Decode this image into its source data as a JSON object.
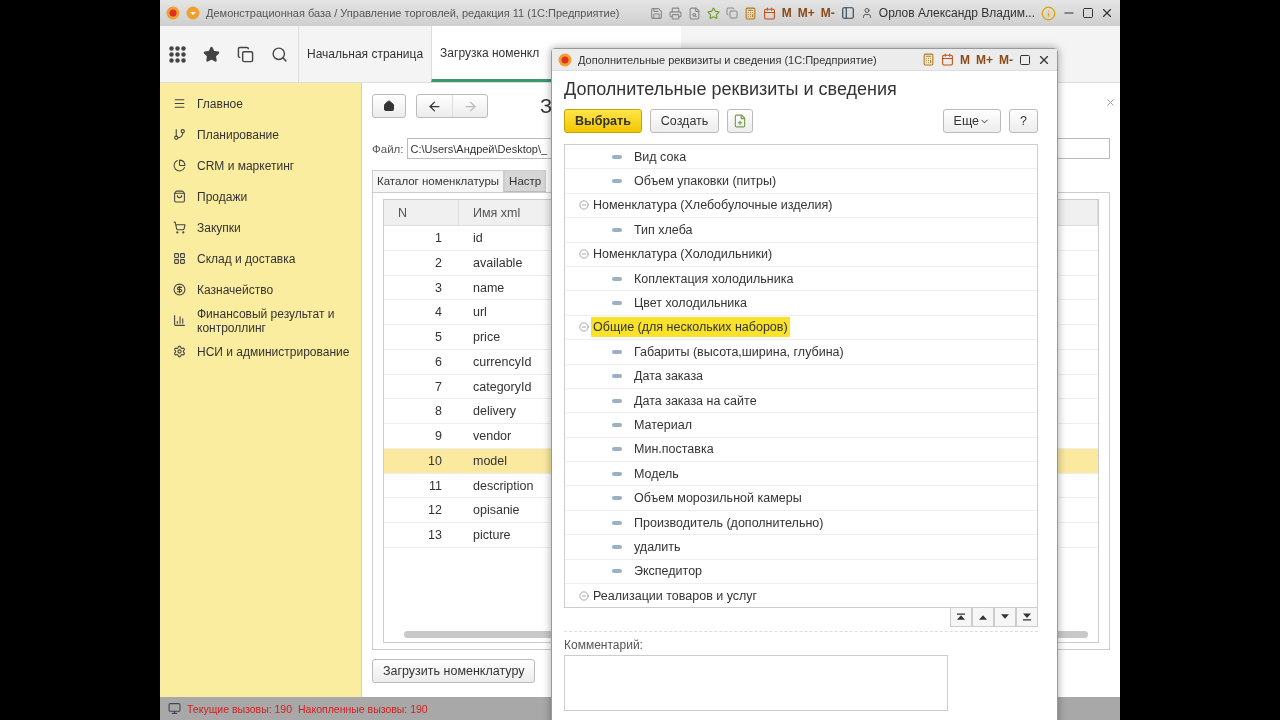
{
  "window": {
    "title": "Демонстрационная база / Управление торговлей, редакция 11  (1С:Предприятие)",
    "memory_buttons": [
      "M",
      "M+",
      "M-"
    ],
    "user": "Орлов Александр Владим..."
  },
  "nav_tabs": [
    {
      "label": "Начальная страница",
      "selected": false
    },
    {
      "label": "Загрузка номенкл",
      "selected": true
    }
  ],
  "sidebar": {
    "items": [
      {
        "label": "Главное"
      },
      {
        "label": "Планирование"
      },
      {
        "label": "CRM и маркетинг"
      },
      {
        "label": "Продажи"
      },
      {
        "label": "Закупки"
      },
      {
        "label": "Склад и доставка"
      },
      {
        "label": "Казначейство"
      },
      {
        "label": "Финансовый результат и контроллинг"
      },
      {
        "label": "НСИ и администрирование"
      }
    ]
  },
  "content": {
    "title": "З",
    "file_label": "Файл:",
    "file_path": "C:\\Users\\Андрей\\Desktop\\_",
    "tabs": [
      {
        "label": "Каталог номенклатуры",
        "selected": true
      },
      {
        "label": "Настр",
        "selected": false
      }
    ],
    "table": {
      "columns": [
        "N",
        "Имя xml"
      ],
      "rows": [
        {
          "n": "1",
          "name": "id",
          "selected": false
        },
        {
          "n": "2",
          "name": "available",
          "selected": false
        },
        {
          "n": "3",
          "name": "name",
          "selected": false
        },
        {
          "n": "4",
          "name": "url",
          "selected": false
        },
        {
          "n": "5",
          "name": "price",
          "selected": false
        },
        {
          "n": "6",
          "name": "currencyId",
          "selected": false
        },
        {
          "n": "7",
          "name": "categoryId",
          "selected": false
        },
        {
          "n": "8",
          "name": "delivery",
          "selected": false
        },
        {
          "n": "9",
          "name": "vendor",
          "selected": false
        },
        {
          "n": "10",
          "name": "model",
          "selected": true
        },
        {
          "n": "11",
          "name": "description",
          "selected": false
        },
        {
          "n": "12",
          "name": "opisanie",
          "selected": false
        },
        {
          "n": "13",
          "name": "picture",
          "selected": false
        }
      ]
    },
    "load_button": "Загрузить номенклатуру"
  },
  "status_bar": {
    "current": "Текущие вызовы: 190",
    "accumulated": "Накопленные вызовы: 190"
  },
  "dialog": {
    "window_title": "Дополнительные реквизиты и сведения  (1С:Предприятие)",
    "memory_buttons": [
      "M",
      "M+",
      "M-"
    ],
    "heading": "Дополнительные реквизиты и сведения",
    "buttons": {
      "select": "Выбрать",
      "create": "Создать",
      "more": "Еще",
      "help": "?"
    },
    "tree": [
      {
        "children": [
          {
            "label": "Вид сока",
            "selected": false
          },
          {
            "label": "Объем упаковки (питры)",
            "selected": false
          }
        ]
      },
      {
        "label": "Номенклатура (Хлебобулочные изделия)",
        "expanded": true,
        "selected": false,
        "children": [
          {
            "label": "Тип хлеба",
            "selected": false
          }
        ]
      },
      {
        "label": "Номенклатура (Холодильники)",
        "expanded": true,
        "selected": false,
        "children": [
          {
            "label": "Коплектация холодильника",
            "selected": false
          },
          {
            "label": "Цвет холодильника",
            "selected": false
          }
        ]
      },
      {
        "label": "Общие (для нескольких наборов)",
        "expanded": true,
        "selected": true,
        "children": [
          {
            "label": "Габариты (высота,ширина, глубина)",
            "selected": false
          },
          {
            "label": "Дата заказа",
            "selected": false
          },
          {
            "label": "Дата заказа на сайте",
            "selected": false
          },
          {
            "label": "Материал",
            "selected": false
          },
          {
            "label": "Мин.поставка",
            "selected": false
          },
          {
            "label": "Модель",
            "selected": false
          },
          {
            "label": "Объем морозильной камеры",
            "selected": false
          },
          {
            "label": "Производитель (дополнительно)",
            "selected": false
          },
          {
            "label": "удалить",
            "selected": false
          },
          {
            "label": "Экспедитор",
            "selected": false
          }
        ]
      },
      {
        "label": "Реализации товаров и услуг",
        "expanded": true,
        "selected": false
      }
    ],
    "comment_label": "Комментарий:"
  }
}
